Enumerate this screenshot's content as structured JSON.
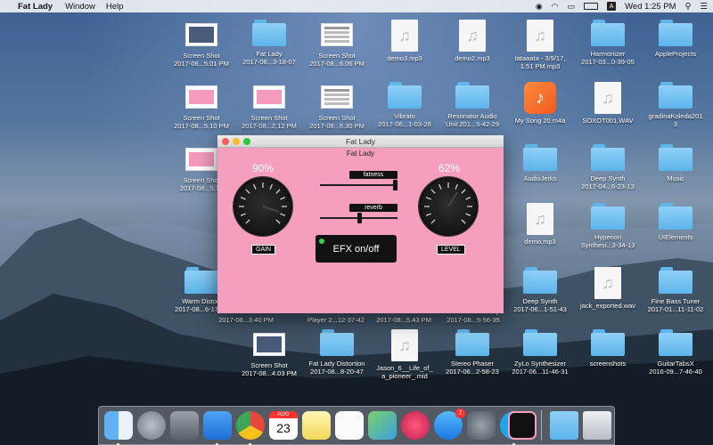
{
  "menubar": {
    "app_name": "Fat Lady",
    "menus": [
      "Window",
      "Help"
    ],
    "clock": "Wed 1:25 PM"
  },
  "desktop_icons": [
    {
      "type": "shot-dark",
      "label1": "Screen Shot",
      "label2": "2017-08...5.01 PM"
    },
    {
      "type": "folder",
      "label1": "Fat Lady",
      "label2": "2017-08...3-18-07"
    },
    {
      "type": "shot-doc",
      "label1": "Screen Shot",
      "label2": "2017-08...6.06 PM"
    },
    {
      "type": "mp3",
      "label1": "demo3.mp3",
      "label2": ""
    },
    {
      "type": "mp3",
      "label1": "demo2.mp3",
      "label2": ""
    },
    {
      "type": "mp3",
      "label1": "tataaata - 3/9/17,",
      "label2": "1.51 PM.mp3"
    },
    {
      "type": "folder",
      "label1": "Harmonizer",
      "label2": "2017-03...0-39-05"
    },
    {
      "type": "folder",
      "label1": "AppleProjects",
      "label2": ""
    },
    {
      "type": "shot-pink",
      "label1": "Screen Shot",
      "label2": "2017-08...5.10 PM"
    },
    {
      "type": "shot-pink",
      "label1": "Screen Shot",
      "label2": "2017-08...2.12 PM"
    },
    {
      "type": "shot-doc",
      "label1": "Screen Shot",
      "label2": "2017-08...6.30 PM"
    },
    {
      "type": "folder",
      "label1": "Vibrato",
      "label2": "2017-06...1-03-28"
    },
    {
      "type": "folder",
      "label1": "Resonator Audio",
      "label2": "Unit 201...5-42-29"
    },
    {
      "type": "garage",
      "label1": "My Song 20.m4a",
      "label2": ""
    },
    {
      "type": "wav",
      "label1": "SOXOT001.WAV",
      "label2": ""
    },
    {
      "type": "folder",
      "label1": "gradinaKoleda201",
      "label2": "3"
    },
    {
      "type": "shot-pink",
      "label1": "Screen Shot",
      "label2": "2017-08...5.16"
    },
    {
      "type": "folder",
      "label1": "AudioJerks",
      "label2": ""
    },
    {
      "type": "folder",
      "label1": "Deep Synth",
      "label2": "2017-04...6-23-13"
    },
    {
      "type": "folder",
      "label1": "Music",
      "label2": ""
    },
    {
      "type": "mp3",
      "label1": "demo.mp3",
      "label2": ""
    },
    {
      "type": "folder",
      "label1": "Hyperion",
      "label2": "Synthesi...3-34-13"
    },
    {
      "type": "folder",
      "label1": "UIElements",
      "label2": ""
    },
    {
      "type": "folder",
      "label1": "Warm Distort",
      "label2": "2017-08...6-17-44"
    },
    {
      "type": "folder",
      "label1": "Deep Synth",
      "label2": "2017-06...1-51-43"
    },
    {
      "type": "wav",
      "label1": "jack_exported.wav",
      "label2": ""
    },
    {
      "type": "folder",
      "label1": "Fine Bass Tuner",
      "label2": "2017-01...11-11-02"
    },
    {
      "type": "shot-dark",
      "label1": "Screen Shot",
      "label2": "2017-08...4.03 PM"
    },
    {
      "type": "folder",
      "label1": "Fat Lady Distortion",
      "label2": "2017-08...8-20-47"
    },
    {
      "type": "mp3",
      "label1": "Jason_6__Life_of_",
      "label2": "a_pioneer_.mid"
    },
    {
      "type": "folder",
      "label1": "Stereo Phaser",
      "label2": "2017-06...2-58-23"
    },
    {
      "type": "folder",
      "label1": "ZyLo Synthesizer",
      "label2": "2017-06...11-46-31"
    },
    {
      "type": "folder",
      "label1": "screenshots",
      "label2": ""
    },
    {
      "type": "folder",
      "label1": "GuitarTabsX",
      "label2": "2016-09...7-46-40"
    }
  ],
  "hidden_row_labels": [
    "2017-08...3.40 PM",
    "Player 2...12-37-42",
    "2017-08...5.43 PM",
    "2017-08...5-56-35"
  ],
  "partial_labels": [
    "53",
    "r",
    "53"
  ],
  "window": {
    "title": "Fat Lady",
    "subtitle": "Fat Lady",
    "gain": {
      "label": "GAIN",
      "percent": "90%",
      "value": 0.9
    },
    "level": {
      "label": "LEVEL",
      "percent": "62%",
      "value": 0.62
    },
    "fatness": {
      "label": "fatness",
      "value": 0.98
    },
    "reverb": {
      "label": "reverb",
      "value": 0.52
    },
    "efx_button": "EFX on/off"
  },
  "dock": {
    "app_store_badge": "7",
    "calendar_month": "AUG",
    "calendar_day": "23"
  },
  "colors": {
    "window_bg": "#f59ebe",
    "folder": "#6cbcf0",
    "led": "#3bd04b"
  }
}
